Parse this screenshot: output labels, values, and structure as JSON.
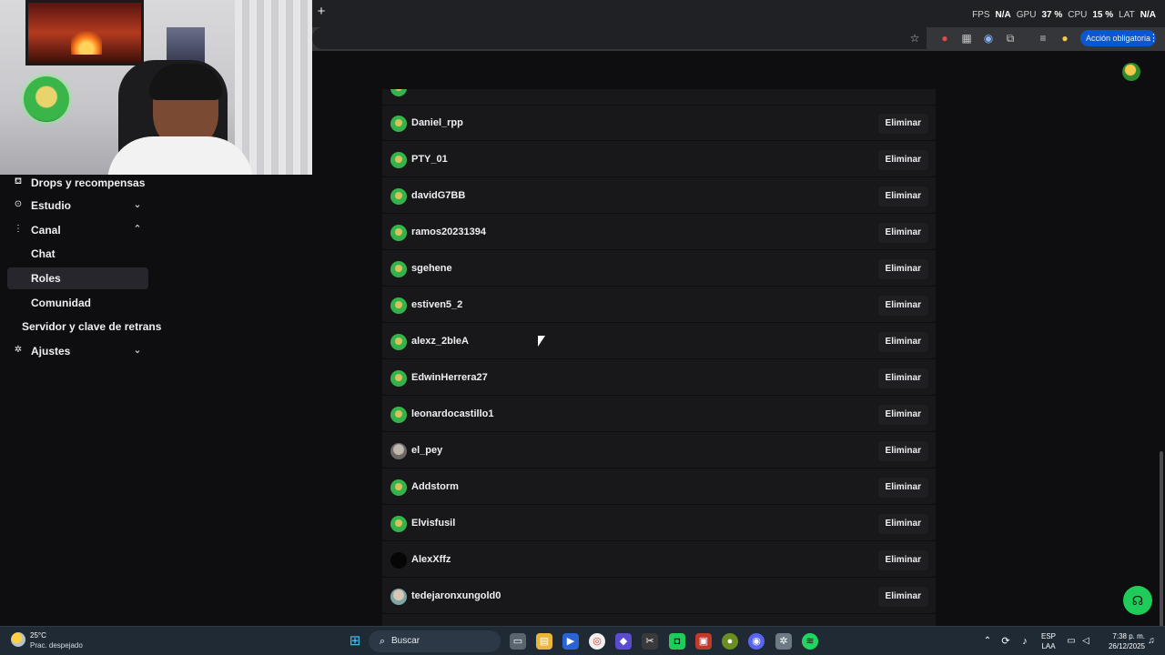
{
  "browser": {
    "new_tab_label": "+",
    "action_button": "Acción obligatoria",
    "menu_icon": "vertical-dots-icon"
  },
  "overlay": {
    "fps_label": "FPS",
    "fps_value": "N/A",
    "gpu_label": "GPU",
    "gpu_value": "37 %",
    "cpu_label": "CPU",
    "cpu_value": "15 %",
    "lat_label": "LAT",
    "lat_value": "N/A"
  },
  "sidebar": {
    "items": [
      {
        "label": "Drops y recompensas",
        "icon": "gift-icon"
      },
      {
        "label": "Estudio",
        "icon": "studio-icon",
        "chevron": "chevron-down-icon"
      },
      {
        "label": "Canal",
        "icon": "channel-icon",
        "chevron": "chevron-up-icon"
      },
      {
        "label": "Chat"
      },
      {
        "label": "Roles"
      },
      {
        "label": "Comunidad"
      },
      {
        "label": "Servidor y clave de retrans"
      },
      {
        "label": "Ajustes",
        "icon": "gear-icon",
        "chevron": "chevron-down-icon"
      }
    ],
    "active_item": "Roles"
  },
  "users": {
    "remove_label": "Eliminar",
    "rows": [
      {
        "name": "Daniel_rpp",
        "avatar": "green"
      },
      {
        "name": "PTY_01",
        "avatar": "green"
      },
      {
        "name": "davidG7BB",
        "avatar": "green"
      },
      {
        "name": "ramos20231394",
        "avatar": "green"
      },
      {
        "name": "sgehene",
        "avatar": "green"
      },
      {
        "name": "estiven5_2",
        "avatar": "green"
      },
      {
        "name": "alexz_2bleA",
        "avatar": "green"
      },
      {
        "name": "EdwinHerrera27",
        "avatar": "green"
      },
      {
        "name": "leonardocastillo1",
        "avatar": "green"
      },
      {
        "name": "el_pey",
        "avatar": "gray"
      },
      {
        "name": "Addstorm",
        "avatar": "green"
      },
      {
        "name": "Elvisfusil",
        "avatar": "green"
      },
      {
        "name": "AlexXffz",
        "avatar": "black"
      },
      {
        "name": "tedejaronxungold0",
        "avatar": "photo"
      }
    ]
  },
  "taskbar": {
    "weather_temp": "25°C",
    "weather_desc": "Prac. despejado",
    "search_label": "Buscar",
    "lang_top": "ESP",
    "lang_bottom": "LAA",
    "time": "7:38 p. m.",
    "date": "26/12/2025",
    "colors": {
      "spotify": "#1ed760",
      "chrome_accent": "#0b57d0",
      "help_button": "#1fcc5a"
    }
  }
}
